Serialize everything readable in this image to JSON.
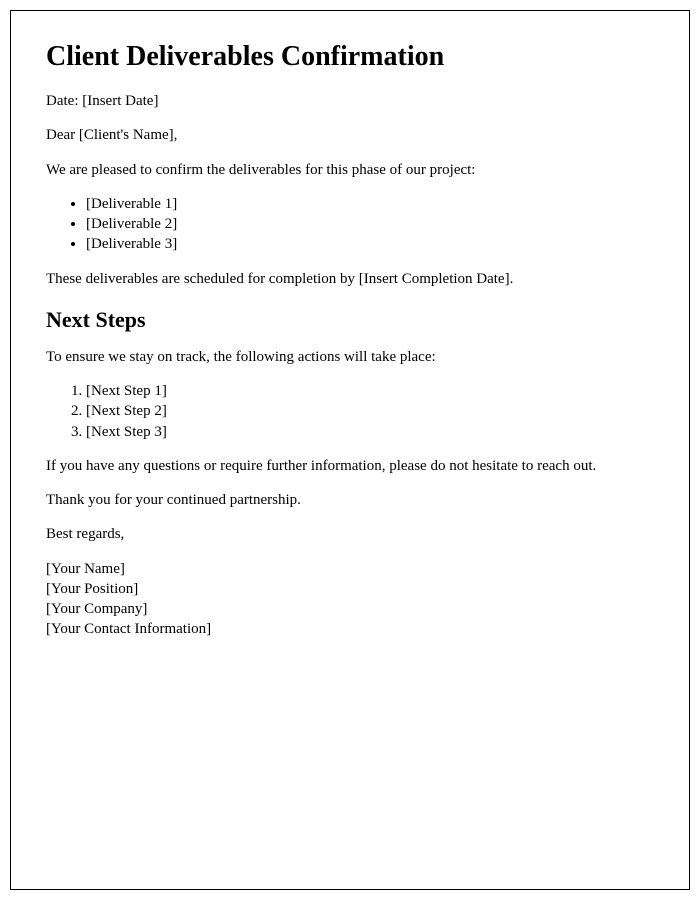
{
  "title": "Client Deliverables Confirmation",
  "date_line": "Date: [Insert Date]",
  "salutation": "Dear [Client's Name],",
  "intro": "We are pleased to confirm the deliverables for this phase of our project:",
  "deliverables": [
    "[Deliverable 1]",
    "[Deliverable 2]",
    "[Deliverable 3]"
  ],
  "schedule_line": "These deliverables are scheduled for completion by [Insert Completion Date].",
  "next_steps_heading": "Next Steps",
  "next_steps_intro": "To ensure we stay on track, the following actions will take place:",
  "next_steps": [
    "[Next Step 1]",
    "[Next Step 2]",
    "[Next Step 3]"
  ],
  "questions_line": "If you have any questions or require further information, please do not hesitate to reach out.",
  "thanks_line": "Thank you for your continued partnership.",
  "closing": "Best regards,",
  "signature": [
    "[Your Name]",
    "[Your Position]",
    "[Your Company]",
    "[Your Contact Information]"
  ]
}
